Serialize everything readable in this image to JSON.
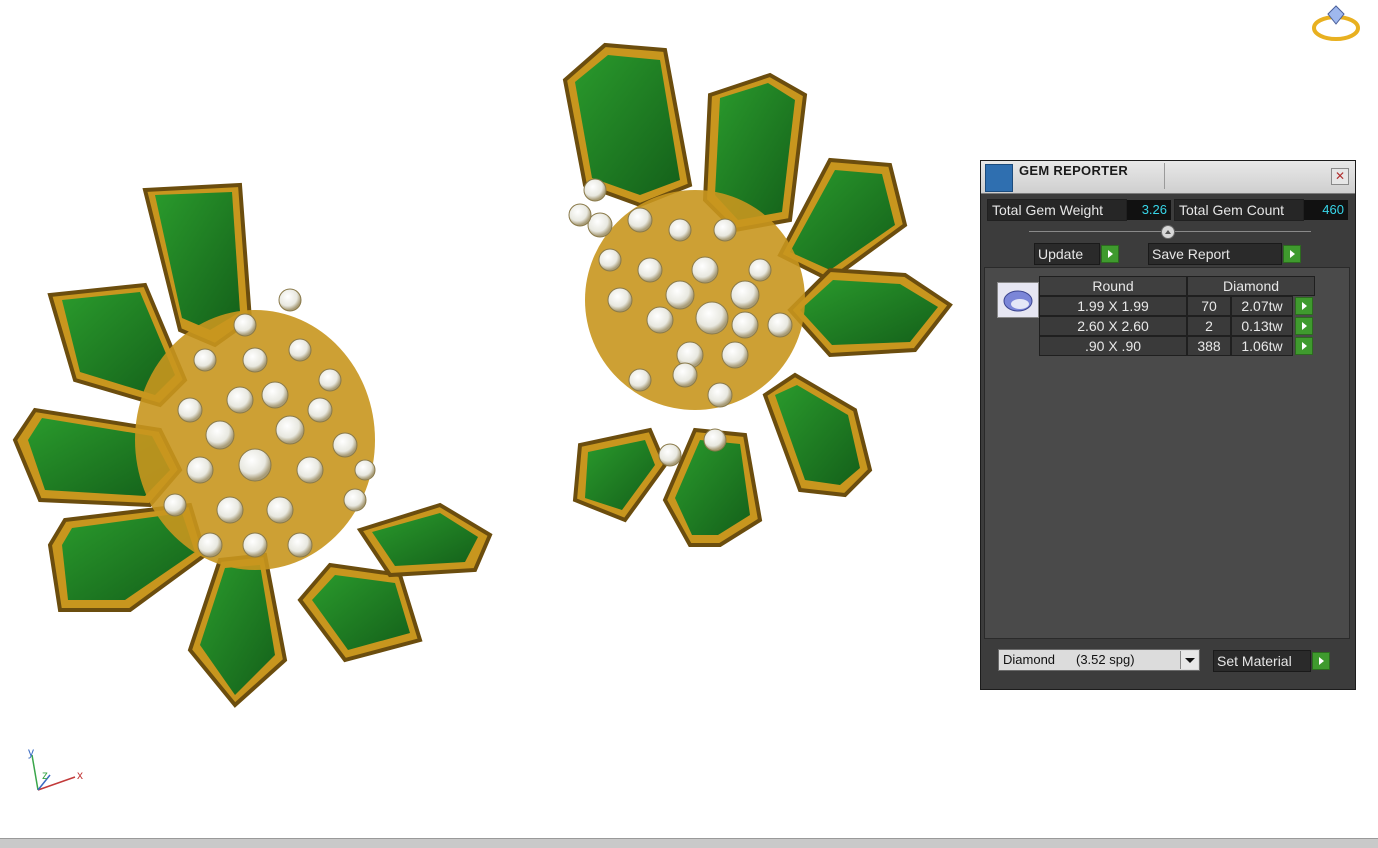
{
  "panel": {
    "title": "GEM REPORTER",
    "close_glyph": "✕",
    "total_weight_label": "Total Gem Weight",
    "total_weight_value": "3.26",
    "total_count_label": "Total Gem Count",
    "total_count_value": "460",
    "update_label": "Update",
    "save_report_label": "Save Report",
    "table": {
      "headers": [
        "Round",
        "Diamond"
      ],
      "rows": [
        {
          "size": "1.99 X 1.99",
          "count": "70",
          "weight": "2.07tw"
        },
        {
          "size": "2.60 X 2.60",
          "count": "2",
          "weight": "0.13tw"
        },
        {
          "size": ".90 X .90",
          "count": "388",
          "weight": "1.06tw"
        }
      ]
    },
    "material": {
      "name": "Diamond",
      "sg": "(3.52 spg)"
    },
    "set_material_label": "Set Material"
  },
  "axis": {
    "y": "y",
    "z": "z",
    "x": "x"
  },
  "colors": {
    "gold": "#c8961e",
    "emerald": "#1f7a21",
    "diamond": "#f2f2ec",
    "accent_value": "#37d5e8",
    "go_button": "#3f9a2e"
  },
  "icons": {
    "logo": "ring-diamond-icon",
    "title": "gem-reporter-icon",
    "close": "close-icon",
    "gem_thumb": "round-diamond-icon"
  }
}
